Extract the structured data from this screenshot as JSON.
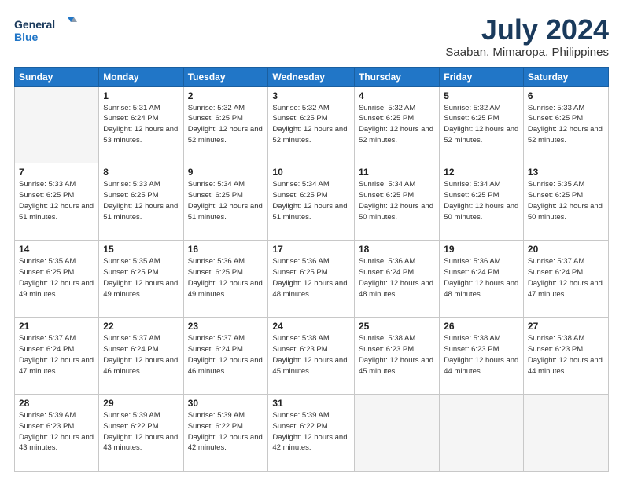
{
  "logo": {
    "line1": "General",
    "line2": "Blue"
  },
  "title": "July 2024",
  "subtitle": "Saaban, Mimaropa, Philippines",
  "days_header": [
    "Sunday",
    "Monday",
    "Tuesday",
    "Wednesday",
    "Thursday",
    "Friday",
    "Saturday"
  ],
  "weeks": [
    [
      {
        "num": "",
        "empty": true
      },
      {
        "num": "1",
        "sunrise": "5:31 AM",
        "sunset": "6:24 PM",
        "daylight": "12 hours and 53 minutes."
      },
      {
        "num": "2",
        "sunrise": "5:32 AM",
        "sunset": "6:25 PM",
        "daylight": "12 hours and 52 minutes."
      },
      {
        "num": "3",
        "sunrise": "5:32 AM",
        "sunset": "6:25 PM",
        "daylight": "12 hours and 52 minutes."
      },
      {
        "num": "4",
        "sunrise": "5:32 AM",
        "sunset": "6:25 PM",
        "daylight": "12 hours and 52 minutes."
      },
      {
        "num": "5",
        "sunrise": "5:32 AM",
        "sunset": "6:25 PM",
        "daylight": "12 hours and 52 minutes."
      },
      {
        "num": "6",
        "sunrise": "5:33 AM",
        "sunset": "6:25 PM",
        "daylight": "12 hours and 52 minutes."
      }
    ],
    [
      {
        "num": "7",
        "sunrise": "5:33 AM",
        "sunset": "6:25 PM",
        "daylight": "12 hours and 51 minutes."
      },
      {
        "num": "8",
        "sunrise": "5:33 AM",
        "sunset": "6:25 PM",
        "daylight": "12 hours and 51 minutes."
      },
      {
        "num": "9",
        "sunrise": "5:34 AM",
        "sunset": "6:25 PM",
        "daylight": "12 hours and 51 minutes."
      },
      {
        "num": "10",
        "sunrise": "5:34 AM",
        "sunset": "6:25 PM",
        "daylight": "12 hours and 51 minutes."
      },
      {
        "num": "11",
        "sunrise": "5:34 AM",
        "sunset": "6:25 PM",
        "daylight": "12 hours and 50 minutes."
      },
      {
        "num": "12",
        "sunrise": "5:34 AM",
        "sunset": "6:25 PM",
        "daylight": "12 hours and 50 minutes."
      },
      {
        "num": "13",
        "sunrise": "5:35 AM",
        "sunset": "6:25 PM",
        "daylight": "12 hours and 50 minutes."
      }
    ],
    [
      {
        "num": "14",
        "sunrise": "5:35 AM",
        "sunset": "6:25 PM",
        "daylight": "12 hours and 49 minutes."
      },
      {
        "num": "15",
        "sunrise": "5:35 AM",
        "sunset": "6:25 PM",
        "daylight": "12 hours and 49 minutes."
      },
      {
        "num": "16",
        "sunrise": "5:36 AM",
        "sunset": "6:25 PM",
        "daylight": "12 hours and 49 minutes."
      },
      {
        "num": "17",
        "sunrise": "5:36 AM",
        "sunset": "6:25 PM",
        "daylight": "12 hours and 48 minutes."
      },
      {
        "num": "18",
        "sunrise": "5:36 AM",
        "sunset": "6:24 PM",
        "daylight": "12 hours and 48 minutes."
      },
      {
        "num": "19",
        "sunrise": "5:36 AM",
        "sunset": "6:24 PM",
        "daylight": "12 hours and 48 minutes."
      },
      {
        "num": "20",
        "sunrise": "5:37 AM",
        "sunset": "6:24 PM",
        "daylight": "12 hours and 47 minutes."
      }
    ],
    [
      {
        "num": "21",
        "sunrise": "5:37 AM",
        "sunset": "6:24 PM",
        "daylight": "12 hours and 47 minutes."
      },
      {
        "num": "22",
        "sunrise": "5:37 AM",
        "sunset": "6:24 PM",
        "daylight": "12 hours and 46 minutes."
      },
      {
        "num": "23",
        "sunrise": "5:37 AM",
        "sunset": "6:24 PM",
        "daylight": "12 hours and 46 minutes."
      },
      {
        "num": "24",
        "sunrise": "5:38 AM",
        "sunset": "6:23 PM",
        "daylight": "12 hours and 45 minutes."
      },
      {
        "num": "25",
        "sunrise": "5:38 AM",
        "sunset": "6:23 PM",
        "daylight": "12 hours and 45 minutes."
      },
      {
        "num": "26",
        "sunrise": "5:38 AM",
        "sunset": "6:23 PM",
        "daylight": "12 hours and 44 minutes."
      },
      {
        "num": "27",
        "sunrise": "5:38 AM",
        "sunset": "6:23 PM",
        "daylight": "12 hours and 44 minutes."
      }
    ],
    [
      {
        "num": "28",
        "sunrise": "5:39 AM",
        "sunset": "6:23 PM",
        "daylight": "12 hours and 43 minutes."
      },
      {
        "num": "29",
        "sunrise": "5:39 AM",
        "sunset": "6:22 PM",
        "daylight": "12 hours and 43 minutes."
      },
      {
        "num": "30",
        "sunrise": "5:39 AM",
        "sunset": "6:22 PM",
        "daylight": "12 hours and 42 minutes."
      },
      {
        "num": "31",
        "sunrise": "5:39 AM",
        "sunset": "6:22 PM",
        "daylight": "12 hours and 42 minutes."
      },
      {
        "num": "",
        "empty": true
      },
      {
        "num": "",
        "empty": true
      },
      {
        "num": "",
        "empty": true
      }
    ]
  ],
  "labels": {
    "sunrise_prefix": "Sunrise: ",
    "sunset_prefix": "Sunset: ",
    "daylight_prefix": "Daylight: "
  }
}
